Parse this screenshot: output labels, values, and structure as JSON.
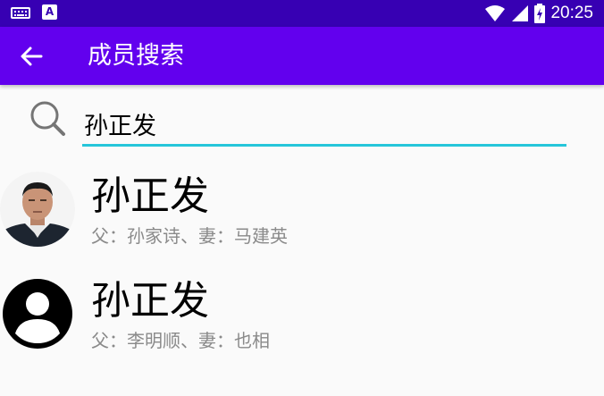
{
  "status_bar": {
    "time": "20:25",
    "app_icon_letter": "A"
  },
  "app_bar": {
    "title": "成员搜索",
    "back_icon": "arrow-left-icon"
  },
  "search": {
    "icon": "search-icon",
    "value": "孙正发",
    "accent_color": "#26c6da"
  },
  "results": [
    {
      "name": "孙正发",
      "relation": "父：孙家诗、妻：马建英",
      "avatar": "photo"
    },
    {
      "name": "孙正发",
      "relation": "父：李明顺、妻：也相",
      "avatar": "default-person-icon"
    }
  ],
  "colors": {
    "status_bar": "#3700b3",
    "app_bar": "#6200ee"
  }
}
